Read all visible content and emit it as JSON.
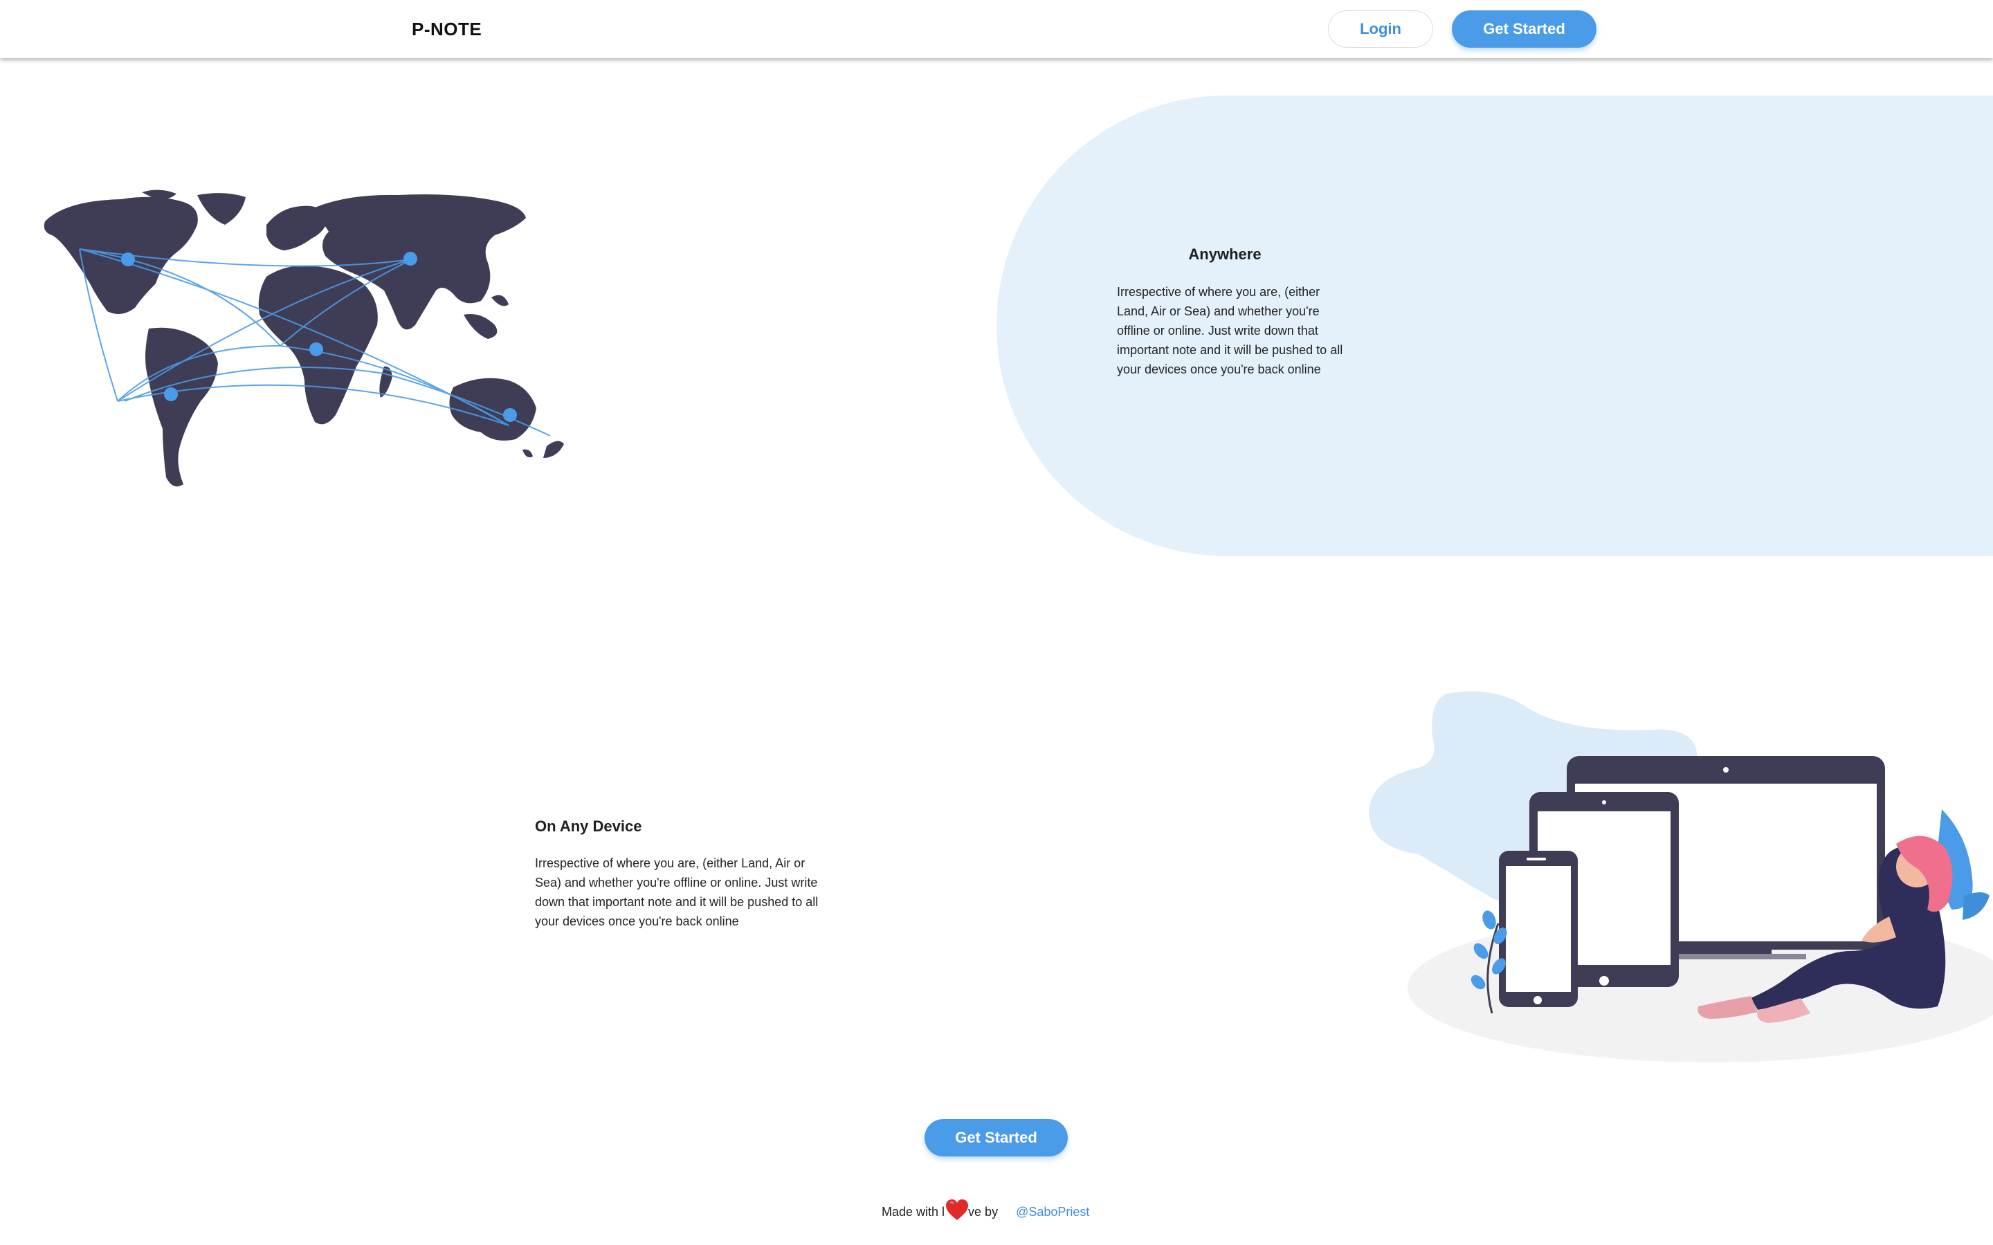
{
  "header": {
    "brand": "P-NOTE",
    "login_label": "Login",
    "get_started_label": "Get Started"
  },
  "section_anywhere": {
    "title": "Anywhere",
    "text": "Irrespective of where you are, (either Land, Air or Sea) and whether you're offline or online. Just write down that important note and it will be pushed to all your devices once you're back online"
  },
  "section_device": {
    "title": "On Any Device",
    "text": "Irrespective of where you are, (either Land, Air or Sea) and whether you're offline or online. Just write down that important note and it will be pushed to all your devices once you're back online"
  },
  "cta": {
    "label": "Get Started"
  },
  "footer": {
    "made_with_prefix": "Made with l",
    "made_with_suffix": "ve by",
    "author": "@SaboPriest"
  },
  "colors": {
    "accent": "#4a9be8",
    "light_blue_bg": "#e4f1fb",
    "dark_shape": "#3f3d56"
  },
  "icons": {
    "heart": "heart-icon"
  }
}
